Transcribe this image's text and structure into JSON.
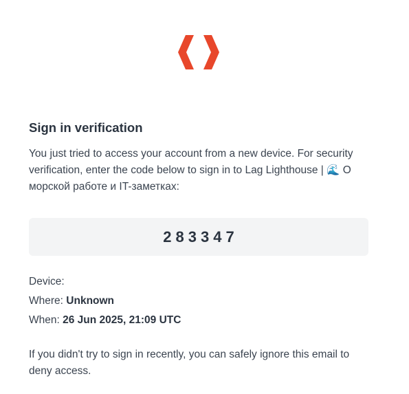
{
  "brand": {
    "logo_icon": "chevrons-logo-icon",
    "accent_color": "#e8472b"
  },
  "email": {
    "title": "Sign in verification",
    "intro": "You just tried to access your account from a new device. For security verification, enter the code below to sign in to Lag Lighthouse | 🌊 О морской работе и IT-заметках:",
    "code": "283347",
    "device_label": "Device:",
    "device_value": "",
    "where_label": "Where:",
    "where_value": "Unknown",
    "when_label": "When:",
    "when_value": "26 Jun 2025, 21:09 UTC",
    "footer": "If you didn't try to sign in recently, you can safely ignore this email to deny access."
  }
}
